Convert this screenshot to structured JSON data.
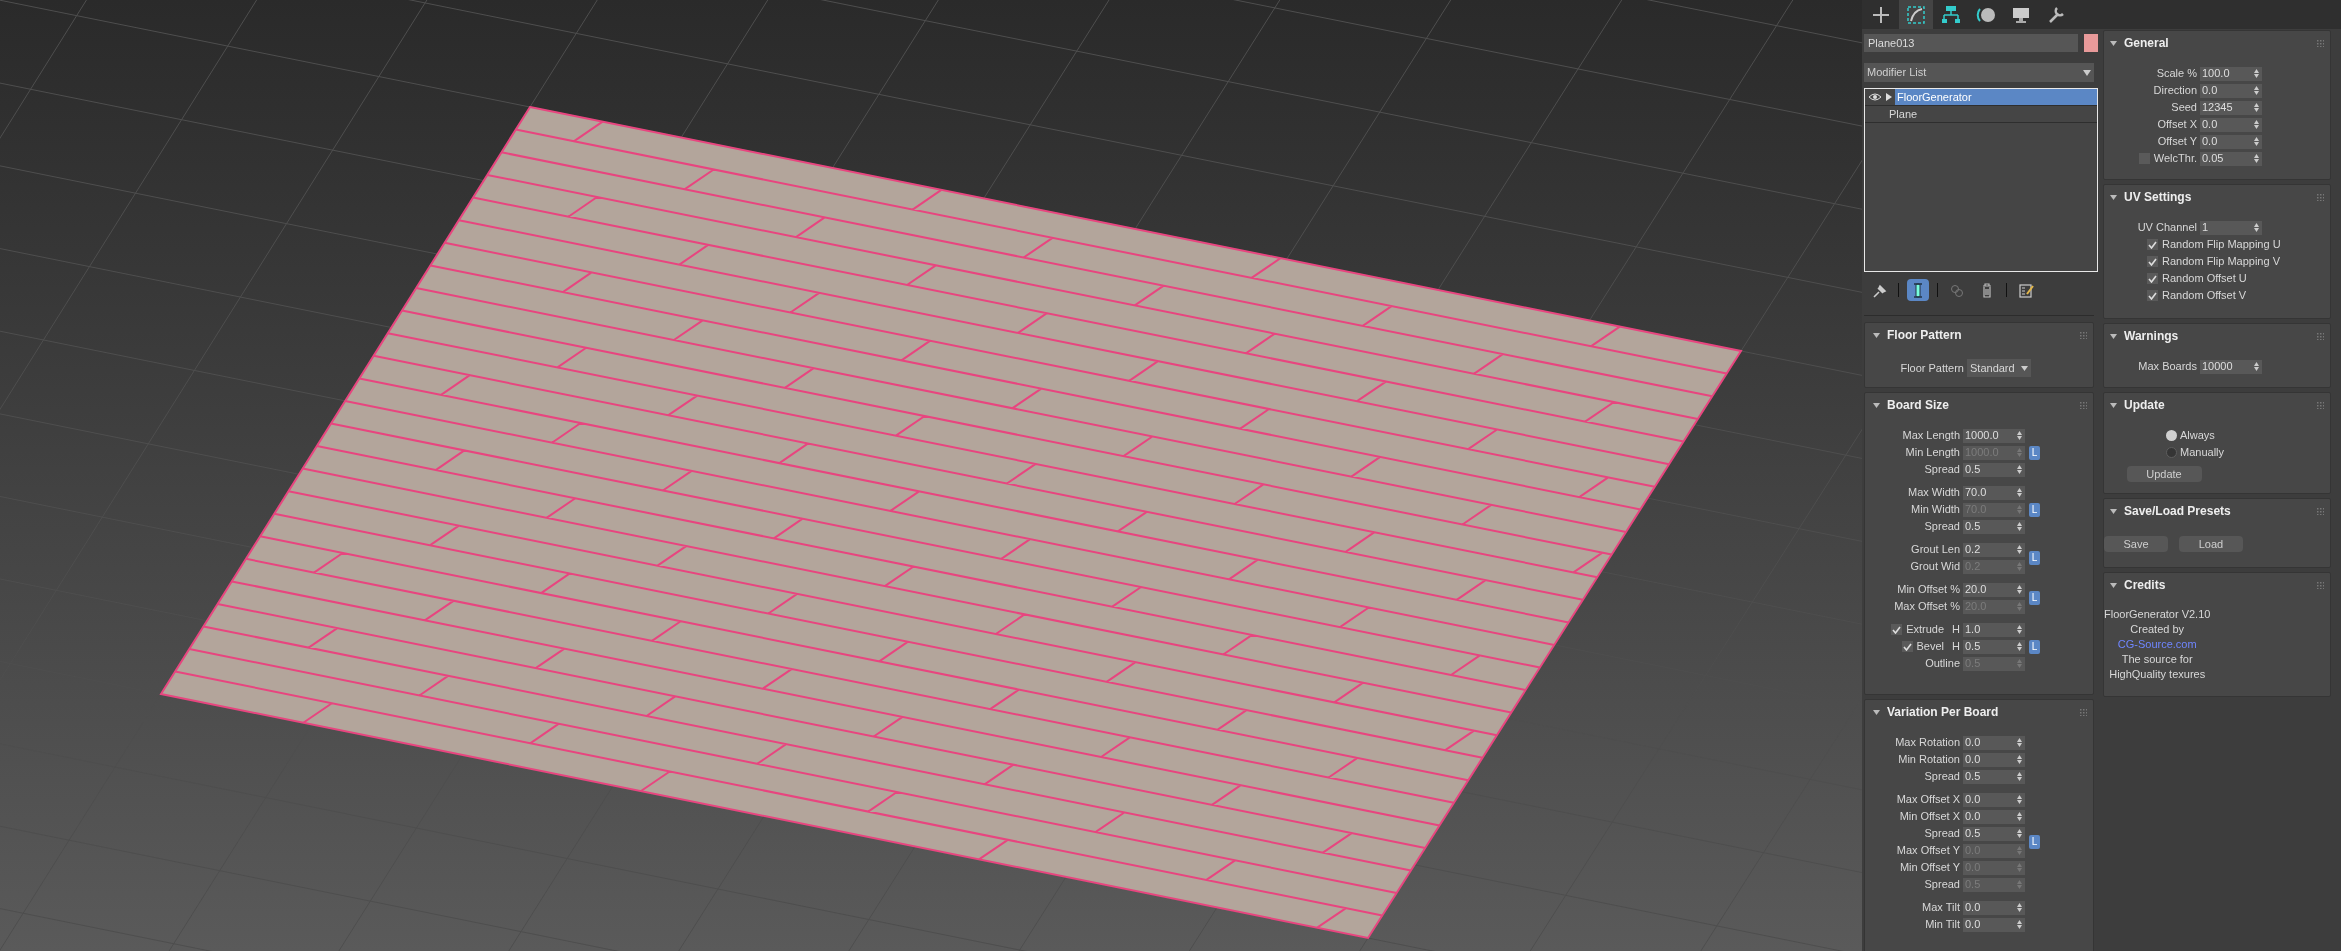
{
  "command_panel_tabs": [
    {
      "kind": "create",
      "selected": false
    },
    {
      "kind": "modify",
      "selected": true
    },
    {
      "kind": "hierarchy",
      "selected": false
    },
    {
      "kind": "motion",
      "selected": false
    },
    {
      "kind": "display",
      "selected": false
    },
    {
      "kind": "utilities",
      "selected": false
    }
  ],
  "object_name": "Plane013",
  "modifier_list": {
    "label": "Modifier List"
  },
  "modifier_stack": [
    {
      "kind": "modifier",
      "label": "FloorGenerator",
      "selected": true
    },
    {
      "kind": "object",
      "label": "Plane",
      "selected": false
    }
  ],
  "stack_tools": [
    {
      "kind": "pin",
      "on": false
    },
    {
      "kind": "show_end_result",
      "on": true
    },
    {
      "kind": "make_unique",
      "on": false
    },
    {
      "kind": "remove",
      "on": false
    },
    {
      "kind": "configure",
      "on": false
    }
  ],
  "left_rollouts": [
    {
      "title": "Floor Pattern",
      "groups": [
        {
          "rows": [
            {
              "kind": "dropdown",
              "label": "Floor Pattern",
              "value": "Standard"
            }
          ]
        }
      ]
    },
    {
      "title": "Board Size",
      "groups": [
        {
          "lock": "L",
          "rows": [
            {
              "kind": "spinner",
              "label": "Max Length",
              "value": "1000.0",
              "disabled": false
            },
            {
              "kind": "spinner",
              "label": "Min Length",
              "value": "1000.0",
              "disabled": true
            },
            {
              "kind": "spinner",
              "label": "Spread",
              "value": "0.5",
              "disabled": false
            }
          ]
        },
        {
          "lock": "L",
          "rows": [
            {
              "kind": "spinner",
              "label": "Max Width",
              "value": "70.0",
              "disabled": false
            },
            {
              "kind": "spinner",
              "label": "Min Width",
              "value": "70.0",
              "disabled": true
            },
            {
              "kind": "spinner",
              "label": "Spread",
              "value": "0.5",
              "disabled": false
            }
          ]
        },
        {
          "lock": "L",
          "rows": [
            {
              "kind": "spinner",
              "label": "Grout Len",
              "value": "0.2",
              "disabled": false
            },
            {
              "kind": "spinner",
              "label": "Grout Wid",
              "value": "0.2",
              "disabled": true
            }
          ]
        },
        {
          "lock": "L",
          "rows": [
            {
              "kind": "spinner",
              "label": "Min Offset %",
              "value": "20.0",
              "disabled": false
            },
            {
              "kind": "spinner",
              "label": "Max Offset %",
              "value": "20.0",
              "disabled": true
            }
          ]
        },
        {
          "lock": "L",
          "rows": [
            {
              "kind": "check_spinner",
              "label": "Extrude",
              "checked": true,
              "suffix": "H",
              "value": "1.0",
              "disabled": false
            },
            {
              "kind": "check_spinner",
              "label": "Bevel",
              "checked": true,
              "suffix": "H",
              "value": "0.5",
              "disabled": false
            },
            {
              "kind": "spinner",
              "label": "Outline",
              "value": "0.5",
              "disabled": true
            }
          ]
        }
      ]
    },
    {
      "title": "Variation Per Board",
      "groups": [
        {
          "rows": [
            {
              "kind": "spinner",
              "label": "Max Rotation",
              "value": "0.0",
              "disabled": false
            },
            {
              "kind": "spinner",
              "label": "Min Rotation",
              "value": "0.0",
              "disabled": false
            },
            {
              "kind": "spinner",
              "label": "Spread",
              "value": "0.5",
              "disabled": false
            }
          ]
        },
        {
          "lock": "L",
          "rows": [
            {
              "kind": "spinner",
              "label": "Max Offset X",
              "value": "0.0",
              "disabled": false
            },
            {
              "kind": "spinner",
              "label": "Min Offset X",
              "value": "0.0",
              "disabled": false
            },
            {
              "kind": "spinner",
              "label": "Spread",
              "value": "0.5",
              "disabled": false
            },
            {
              "kind": "spinner",
              "label": "Max Offset Y",
              "value": "0.0",
              "disabled": true
            },
            {
              "kind": "spinner",
              "label": "Min Offset Y",
              "value": "0.0",
              "disabled": true
            },
            {
              "kind": "spinner",
              "label": "Spread",
              "value": "0.5",
              "disabled": true
            }
          ]
        },
        {
          "rows": [
            {
              "kind": "spinner",
              "label": "Max Tilt",
              "value": "0.0",
              "disabled": false
            },
            {
              "kind": "spinner",
              "label": "Min Tilt",
              "value": "0.0",
              "disabled": false
            }
          ]
        }
      ]
    }
  ],
  "right_rollouts": [
    {
      "title": "General",
      "groups": [
        {
          "rows": [
            {
              "kind": "spinner",
              "label": "Scale %",
              "value": "100.0",
              "disabled": false
            },
            {
              "kind": "spinner",
              "label": "Direction",
              "value": "0.0",
              "disabled": false
            },
            {
              "kind": "spinner",
              "label": "Seed",
              "value": "12345",
              "disabled": false
            },
            {
              "kind": "spinner",
              "label": "Offset X",
              "value": "0.0",
              "disabled": false
            },
            {
              "kind": "spinner",
              "label": "Offset Y",
              "value": "0.0",
              "disabled": false
            },
            {
              "kind": "check_spinner",
              "label": "WelcThr.",
              "checked": false,
              "value": "0.05",
              "disabled": false
            }
          ]
        }
      ]
    },
    {
      "title": "UV Settings",
      "groups": [
        {
          "rows": [
            {
              "kind": "spinner",
              "label": "UV Channel",
              "value": "1",
              "disabled": false
            },
            {
              "kind": "checkbox",
              "label": "Random Flip Mapping U",
              "checked": true
            },
            {
              "kind": "checkbox",
              "label": "Random Flip Mapping V",
              "checked": true
            },
            {
              "kind": "checkbox",
              "label": "Random Offset U",
              "checked": true
            },
            {
              "kind": "checkbox",
              "label": "Random Offset V",
              "checked": true
            }
          ]
        }
      ]
    },
    {
      "title": "Warnings",
      "groups": [
        {
          "rows": [
            {
              "kind": "spinner",
              "label": "Max Boards",
              "value": "10000",
              "disabled": false
            }
          ]
        }
      ]
    },
    {
      "title": "Update",
      "groups": [
        {
          "rows": [
            {
              "kind": "radio",
              "label": "Always",
              "selected": true
            },
            {
              "kind": "radio",
              "label": "Manually",
              "selected": false
            },
            {
              "kind": "button",
              "label": "Update"
            }
          ]
        }
      ]
    },
    {
      "title": "Save/Load Presets",
      "groups": [
        {
          "rows": [
            {
              "kind": "buttons",
              "labels": [
                "Save",
                "Load"
              ]
            }
          ]
        }
      ]
    },
    {
      "title": "Credits",
      "groups": [
        {
          "rows": [
            {
              "kind": "text",
              "text": "FloorGenerator V2.10"
            },
            {
              "kind": "text",
              "text": "Created by"
            },
            {
              "kind": "link",
              "text": "CG-Source.com"
            },
            {
              "kind": "text",
              "text": "The source for"
            },
            {
              "kind": "text",
              "text": "HighQuality texures"
            }
          ]
        }
      ]
    }
  ]
}
